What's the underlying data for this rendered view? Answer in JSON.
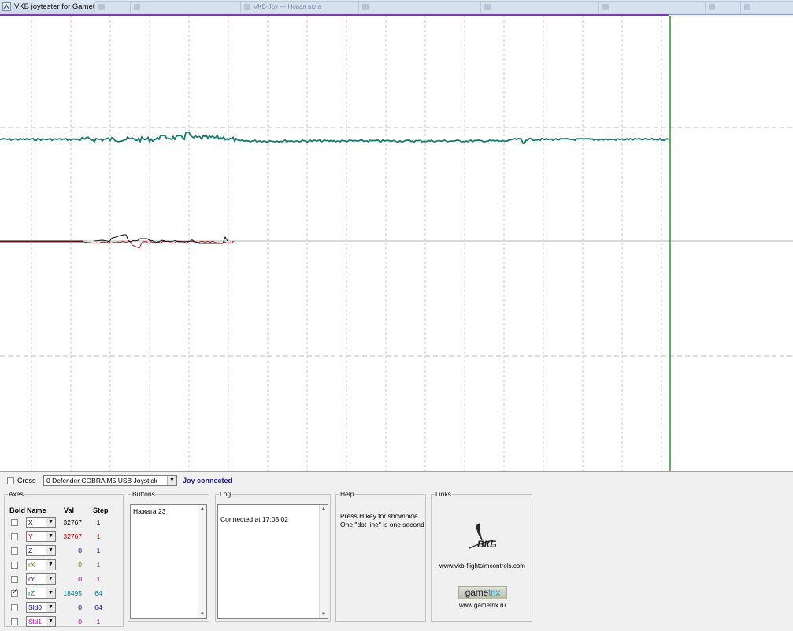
{
  "window": {
    "title": "VKB joytester for Gametrix",
    "background_tabs": [
      "",
      "",
      "VKB-Joy — Новая вкла",
      "",
      "",
      "",
      "",
      ""
    ]
  },
  "graph": {
    "background": "#ffffff",
    "grid_color": "#c8c8c8",
    "cursor_color": "#3c8a3c",
    "axis_colors": {
      "rZ": "#1a7a72",
      "X": "#111111",
      "Y": "#a01818"
    }
  },
  "toolbar": {
    "cross_label": "Cross",
    "cross_checked": false,
    "joystick_selected": "0 Defender COBRA M5 USB Joystick",
    "status": "Joy connected"
  },
  "axes": {
    "legend": "Axes",
    "headers": {
      "bold": "Bold",
      "name": "Name",
      "val": "Val",
      "step": "Step"
    },
    "rows": [
      {
        "name": "X",
        "val": "32767",
        "step": "1",
        "color": "#000000",
        "bold": false
      },
      {
        "name": "Y",
        "val": "32767",
        "step": "1",
        "color": "#c00000",
        "bold": false
      },
      {
        "name": "Z",
        "val": "0",
        "step": "1",
        "color": "#0000a0",
        "bold": false
      },
      {
        "name": "rX",
        "val": "0",
        "step": "1",
        "color": "#7a7a00",
        "bold": false
      },
      {
        "name": "rY",
        "val": "0",
        "step": "1",
        "color": "#800080",
        "bold": false
      },
      {
        "name": "rZ",
        "val": "18495",
        "step": "64",
        "color": "#008080",
        "bold": true
      },
      {
        "name": "Sld0",
        "val": "0",
        "step": "64",
        "color": "#000080",
        "bold": false
      },
      {
        "name": "Sld1",
        "val": "0",
        "step": "1",
        "color": "#c000c0",
        "bold": false
      }
    ]
  },
  "buttons": {
    "legend": "Buttons",
    "lines": [
      "Нажата 23"
    ]
  },
  "log": {
    "legend": "Log",
    "lines": [
      "Connected at 17:05:02"
    ]
  },
  "help": {
    "legend": "Help",
    "lines": [
      "Press H key for show\\hide",
      "One \"dot line\" is one second"
    ]
  },
  "links": {
    "legend": "Links",
    "vkb_logo_text": "ВКБ",
    "vkb_url": "www.vkb-flightsimcontrols.com",
    "gametrix_logo_a": "game",
    "gametrix_logo_b": "trix",
    "gametrix_url": "www.gametrix.ru"
  }
}
